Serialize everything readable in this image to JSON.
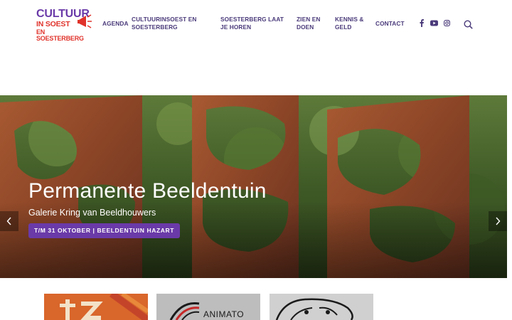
{
  "logo": {
    "line1": "CULTUUR",
    "line2": "IN SOEST",
    "line3": "EN SOESTERBERG"
  },
  "nav": {
    "items": [
      {
        "label": "AGENDA"
      },
      {
        "label": "CULTUURINSOEST EN SOESTERBERG"
      },
      {
        "label": "SOESTERBERG LAAT JE HOREN"
      },
      {
        "label": "ZIEN EN DOEN"
      },
      {
        "label": "KENNIS & GELD"
      },
      {
        "label": "CONTACT"
      }
    ]
  },
  "social": {
    "icons": [
      "facebook-icon",
      "youtube-icon",
      "instagram-icon"
    ]
  },
  "hero": {
    "title": "Permanente Beeldentuin",
    "subtitle": "Galerie Kring van Beeldhouwers",
    "badge": "T/M 31 OKTOBER | BEELDENTUIN HAZART"
  },
  "cards": [
    {
      "text": ""
    },
    {
      "text": "ANIMATO"
    },
    {
      "text": ""
    }
  ],
  "colors": {
    "accent_purple": "#6a3aa8",
    "brand_red": "#e0332b",
    "nav_text": "#4a3a7a"
  }
}
